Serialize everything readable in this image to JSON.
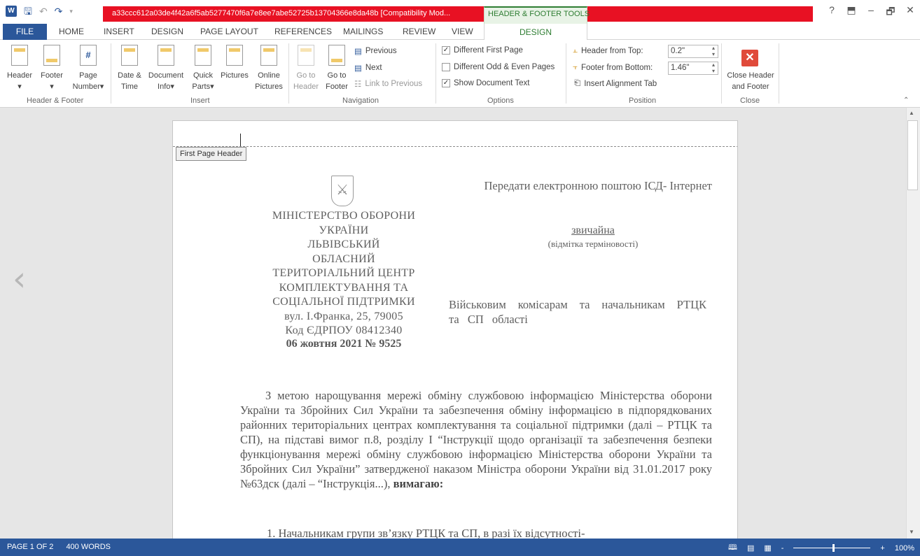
{
  "titlebar": {
    "title": "a33ccc612a03de4f42a6f5ab5277470f6a7e8ee7abe52725b13704366e8da48b [Compatibility Mod...",
    "contextual_label": "HEADER & FOOTER TOOLS",
    "help": "?",
    "minimize": "–",
    "restore": "🗗",
    "close": "✕"
  },
  "tabs": {
    "file": "FILE",
    "home": "HOME",
    "insert": "INSERT",
    "design": "DESIGN",
    "page_layout": "PAGE LAYOUT",
    "references": "REFERENCES",
    "mailings": "MAILINGS",
    "review": "REVIEW",
    "view": "VIEW",
    "hf_design": "DESIGN"
  },
  "ribbon": {
    "header_footer": {
      "label": "Header & Footer",
      "header": "Header",
      "footer": "Footer",
      "page_number_1": "Page",
      "page_number_2": "Number"
    },
    "insert": {
      "label": "Insert",
      "date_time_1": "Date &",
      "date_time_2": "Time",
      "doc_info_1": "Document",
      "doc_info_2": "Info",
      "quick_parts_1": "Quick",
      "quick_parts_2": "Parts",
      "pictures": "Pictures",
      "online_pictures_1": "Online",
      "online_pictures_2": "Pictures"
    },
    "navigation": {
      "label": "Navigation",
      "go_header_1": "Go to",
      "go_header_2": "Header",
      "go_footer_1": "Go to",
      "go_footer_2": "Footer",
      "previous": "Previous",
      "next": "Next",
      "link_previous": "Link to Previous"
    },
    "options": {
      "label": "Options",
      "different_first": "Different First Page",
      "different_odd_even": "Different Odd & Even Pages",
      "show_doc_text": "Show Document Text",
      "different_first_checked": true,
      "different_odd_even_checked": false,
      "show_doc_text_checked": true
    },
    "position": {
      "label": "Position",
      "header_from_top": "Header from Top:",
      "header_from_top_value": "0.2\"",
      "footer_from_bottom": "Footer from Bottom:",
      "footer_from_bottom_value": "1.46\"",
      "insert_alignment_tab": "Insert Alignment Tab"
    },
    "close": {
      "label": "Close",
      "close_1": "Close Header",
      "close_2": "and Footer"
    }
  },
  "document": {
    "header_tag": "First Page Header",
    "send_line": "Передати електронною поштою ІСД- Інтернет",
    "urgency": "звичайна",
    "urgency_note": "(відмітка терміновості)",
    "ministry_lines": [
      "МІНІСТЕРСТВО ОБОРОНИ",
      "УКРАЇНИ",
      "ЛЬВІВСЬКИЙ",
      "ОБЛАСНИЙ",
      "ТЕРИТОРІАЛЬНИЙ ЦЕНТР",
      "КОМПЛЕКТУВАННЯ ТА",
      "СОЦІАЛЬНОЇ ПІДТРИМКИ",
      "вул. І.Франка, 25, 79005",
      "Код ЄДРПОУ 08412340"
    ],
    "date_number": "06 жовтня 2021 № 9525",
    "addressee": "Військовим комісарам та начальникам РТЦК та СП області",
    "body_main": "З метою нарощування мережі обміну службовою інформацією Міністерства оборони України та Збройних Сил України та забезпечення обміну інформацією в підпорядкованих районних територіальних центрах комплектування та соціальної підтримки (далі – РТЦК та СП), на підставі вимог п.8, розділу І “Інструкції щодо організації та забезпечення безпеки функціонування мережі обміну службовою інформацією Міністерства оборони України та Збройних Сил України” затвердженої наказом Міністра оборони України від 31.01.2017 року №63дск (далі – “Інструкція...), ",
    "body_bold": "вимагаю:",
    "item1": "1.      Начальникам   групи зв’язку РТЦК та СП, в разі їх відсутності-"
  },
  "statusbar": {
    "page": "PAGE 1 OF 2",
    "words": "400 WORDS",
    "zoom_minus": "-",
    "zoom_plus": "+",
    "zoom": "100%"
  },
  "colors": {
    "accent": "#2b579a",
    "title_bar": "#e81123",
    "context_tab": "#2e7d32"
  }
}
